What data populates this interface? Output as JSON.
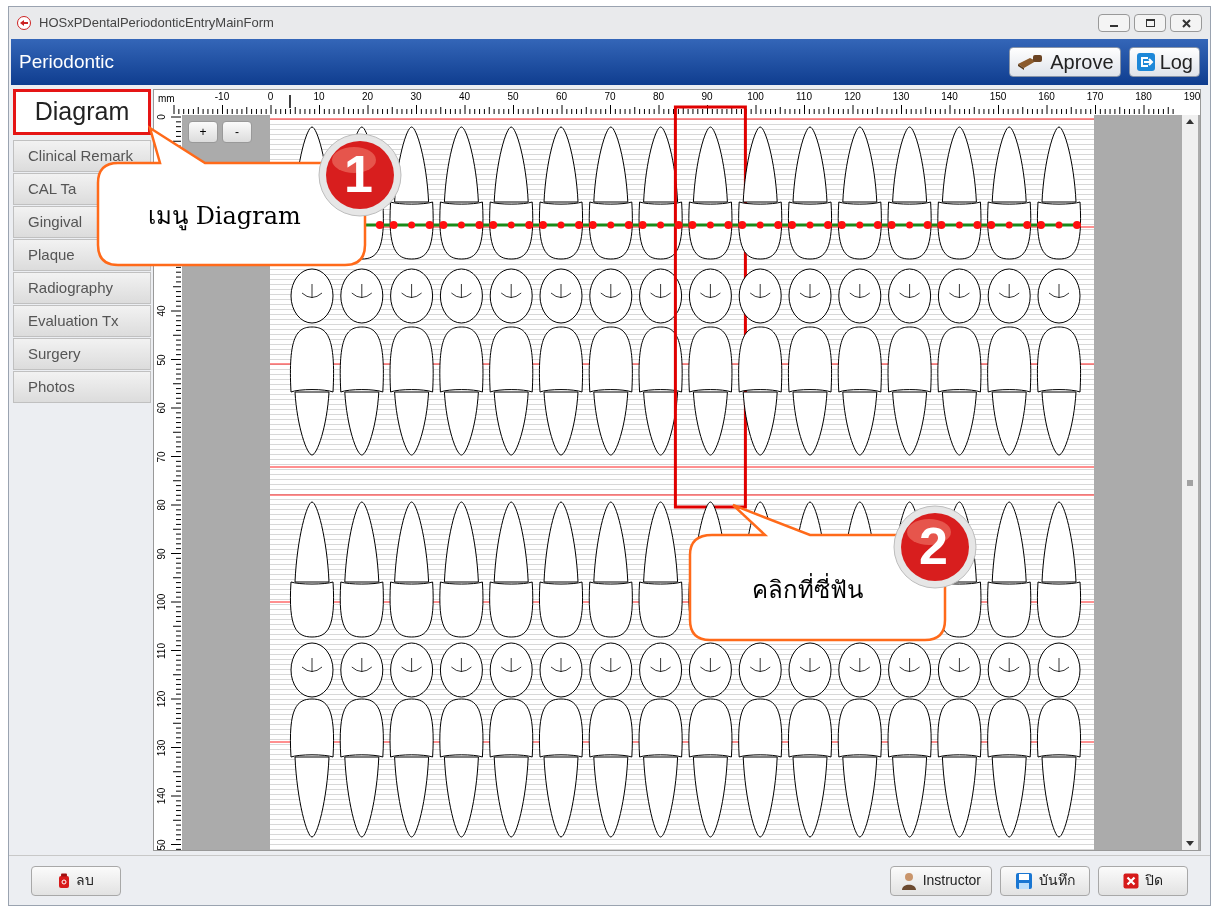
{
  "window": {
    "title": "HOSxPDentalPeriodonticEntryMainForm"
  },
  "header": {
    "title": "Periodontic",
    "buttons": [
      {
        "label": "Aprove",
        "kind": "approve"
      },
      {
        "label": "Log",
        "kind": "log"
      }
    ]
  },
  "sidebar": {
    "tabs": [
      {
        "label": "Diagram",
        "selected": true
      },
      {
        "label": "Clinical Remark",
        "selected": false
      },
      {
        "label": "CAL Ta",
        "selected": false
      },
      {
        "label": "Gingival",
        "selected": false
      },
      {
        "label": "Plaque",
        "selected": false
      },
      {
        "label": "Radiography",
        "selected": false
      },
      {
        "label": "Evaluation Tx",
        "selected": false
      },
      {
        "label": "Surgery",
        "selected": false
      },
      {
        "label": "Photos",
        "selected": false
      }
    ]
  },
  "chart": {
    "top_ruler": {
      "unit": "mm",
      "labels": [
        "-10",
        "0",
        "10",
        "20",
        "30",
        "40",
        "50",
        "60",
        "70",
        "80",
        "90",
        "100",
        "110",
        "120",
        "130",
        "140",
        "150",
        "160",
        "170",
        "180",
        "190"
      ]
    },
    "left_ruler": {
      "labels": [
        "0",
        "40",
        "50",
        "60",
        "70",
        "80",
        "90",
        "100",
        "110",
        "120",
        "130",
        "140",
        "50"
      ]
    },
    "zoom_buttons": [
      "+",
      "-"
    ],
    "teeth": {
      "upper": [
        {
          "selected": false
        },
        {
          "selected": false
        },
        {
          "selected": false
        },
        {
          "selected": false
        },
        {
          "selected": false
        },
        {
          "selected": false
        },
        {
          "selected": false
        },
        {
          "selected": false
        },
        {
          "selected": true
        },
        {
          "selected": false
        },
        {
          "selected": false
        },
        {
          "selected": false
        },
        {
          "selected": false
        },
        {
          "selected": false
        },
        {
          "selected": false
        },
        {
          "selected": false
        }
      ],
      "lower": [
        {
          "selected": false
        },
        {
          "selected": false
        },
        {
          "selected": false
        },
        {
          "selected": false
        },
        {
          "selected": false
        },
        {
          "selected": false
        },
        {
          "selected": false
        },
        {
          "selected": false
        },
        {
          "selected": false
        },
        {
          "selected": false
        },
        {
          "selected": false
        },
        {
          "selected": false
        },
        {
          "selected": false
        },
        {
          "selected": false
        },
        {
          "selected": false
        },
        {
          "selected": false
        }
      ]
    }
  },
  "callouts": [
    {
      "number": "1",
      "text": "เมนู Diagram"
    },
    {
      "number": "2",
      "text": "คลิกที่ซี่ฟัน"
    }
  ],
  "footer": {
    "buttons": [
      {
        "label": "ลบ",
        "kind": "delete"
      },
      {
        "label": "Instructor",
        "kind": "instructor"
      },
      {
        "label": "บันทึก",
        "kind": "save"
      },
      {
        "label": "ปิด",
        "kind": "close"
      }
    ]
  }
}
